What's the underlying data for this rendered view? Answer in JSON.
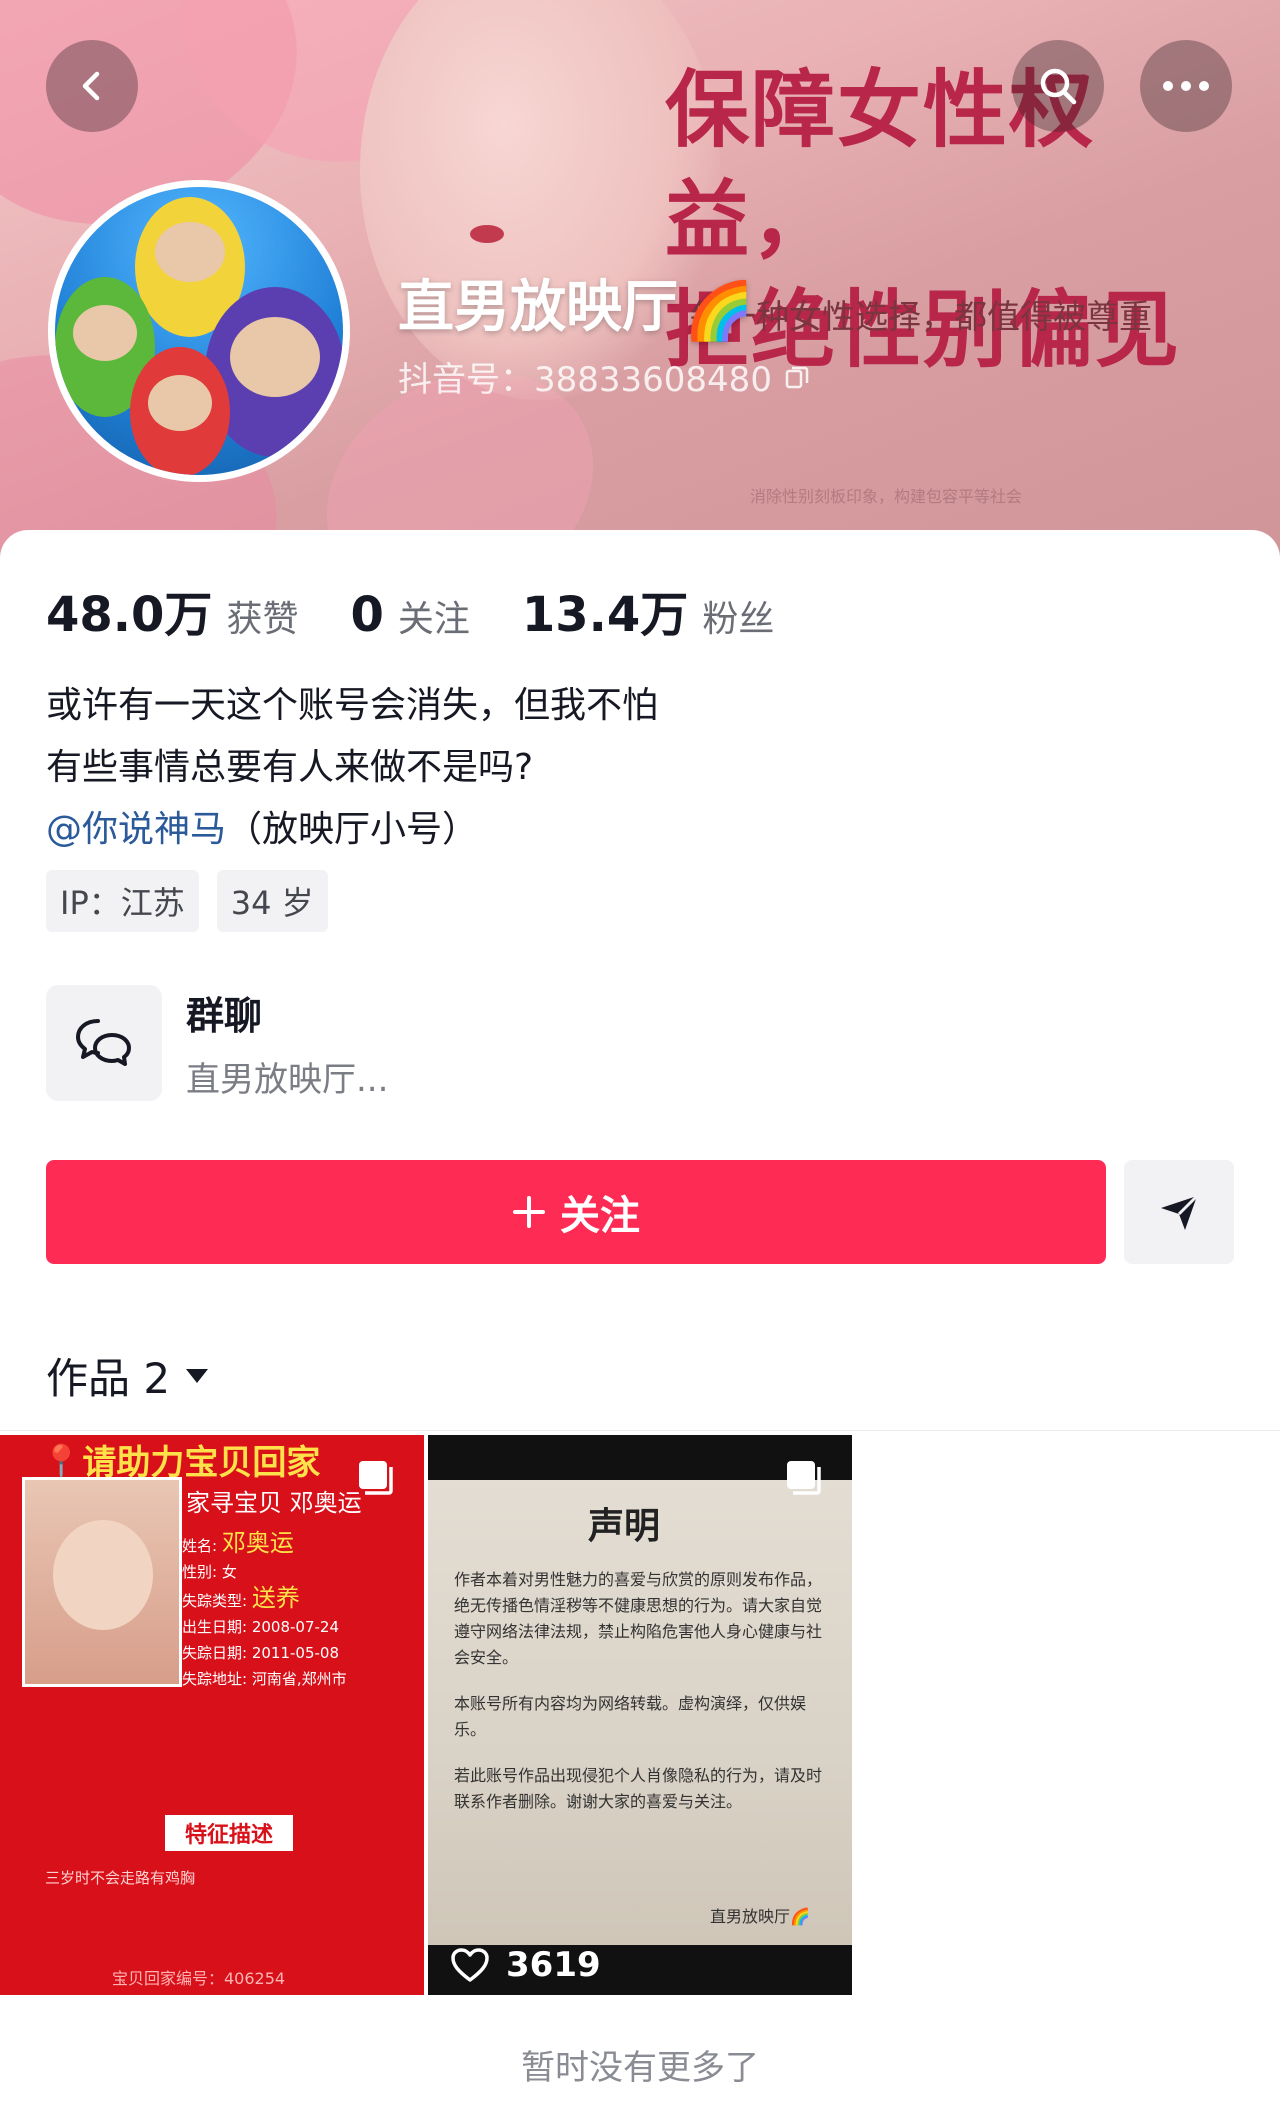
{
  "banner": {
    "slogan_line1": "保障女性权益，",
    "slogan_line2": "拒绝性别偏见",
    "slogan_sub": "每一种女性选择，都值得被尊重",
    "small_caption": "消除性别刻板印象，构建包容平等社会"
  },
  "profile": {
    "nickname": "直男放映厅",
    "rainbow_emoji": "🌈",
    "douyin_id": "抖音号：38833608480"
  },
  "stats": {
    "likes_num": "48.0万",
    "likes_label": "获赞",
    "following_num": "0",
    "following_label": "关注",
    "followers_num": "13.4万",
    "followers_label": "粉丝"
  },
  "bio": {
    "line1": "或许有一天这个账号会消失，但我不怕",
    "line2": "有些事情总要有人来做不是吗?",
    "mention": "@你说神马",
    "mention_suffix": "（放映厅小号）"
  },
  "tags": [
    "IP：江苏",
    "34 岁"
  ],
  "group_chat": {
    "title": "群聊",
    "subtitle": "直男放映厅..."
  },
  "actions": {
    "follow_label": "关注"
  },
  "works": {
    "label": "作品 2"
  },
  "videos": [
    {
      "headline": "请助力宝贝回家",
      "subtitle": "家寻宝贝 邓奥运",
      "name_key": "姓名:",
      "name_val": "邓奥运",
      "gender": "性别:  女",
      "type_key": "失踪类型:",
      "type_val": "送养",
      "birth": "出生日期:  2008-07-24",
      "lost_date": "失踪日期:  2011-05-08",
      "lost_place": "失踪地址:  河南省,郑州市",
      "feature_label": "特征描述",
      "feature_text": "三岁时不会走路有鸡胸",
      "case_no": "宝贝回家编号：406254"
    },
    {
      "title": "声明",
      "para1": "作者本着对男性魅力的喜爱与欣赏的原则发布作品，绝无传播色情淫秽等不健康思想的行为。请大家自觉遵守网络法律法规，禁止构陷危害他人身心健康与社会安全。",
      "para2": "本账号所有内容均为网络转载。虚构演绎，仅供娱乐。",
      "para3": "若此账号作品出现侵犯个人肖像隐私的行为，请及时联系作者删除。谢谢大家的喜爱与关注。",
      "sign": "直男放映厅🌈",
      "likes": "3619"
    }
  ],
  "footer": {
    "no_more": "暂时没有更多了"
  },
  "colors": {
    "accent": "#fe2c55",
    "mention": "#2b5a9b",
    "text": "#161823"
  }
}
